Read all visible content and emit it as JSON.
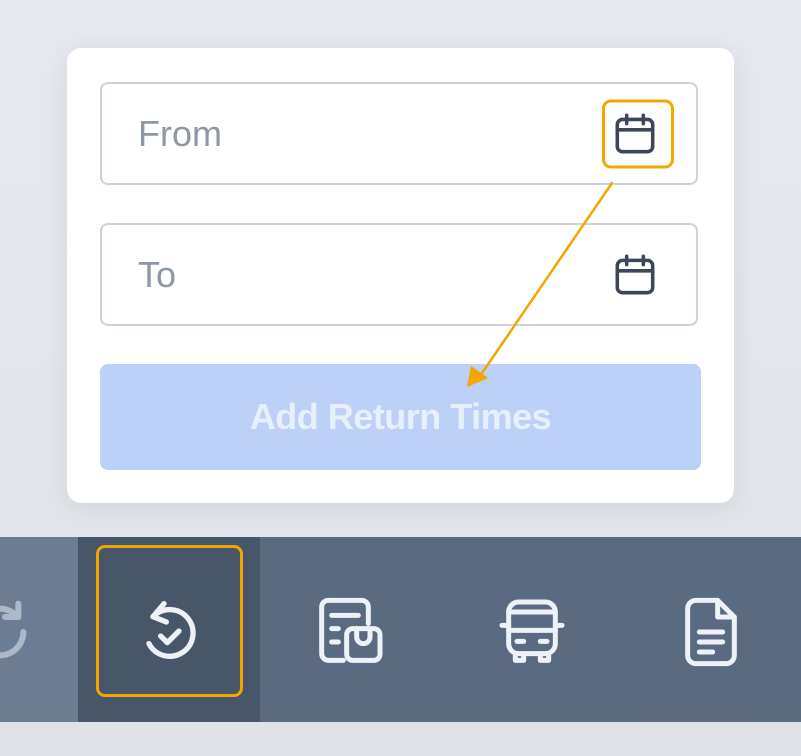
{
  "form": {
    "from_placeholder": "From",
    "to_placeholder": "To",
    "add_button_label": "Add Return Times"
  },
  "icons": {
    "from_calendar": "calendar-icon",
    "to_calendar": "calendar-icon",
    "toolbar": [
      "sync-icon",
      "return-history-icon",
      "package-list-icon",
      "truck-icon",
      "document-icon"
    ]
  },
  "colors": {
    "highlight": "#f5a500",
    "button_disabled_bg": "#bcd0f8",
    "toolbar_bg": "#5a6a81",
    "toolbar_active_bg": "#475669"
  }
}
